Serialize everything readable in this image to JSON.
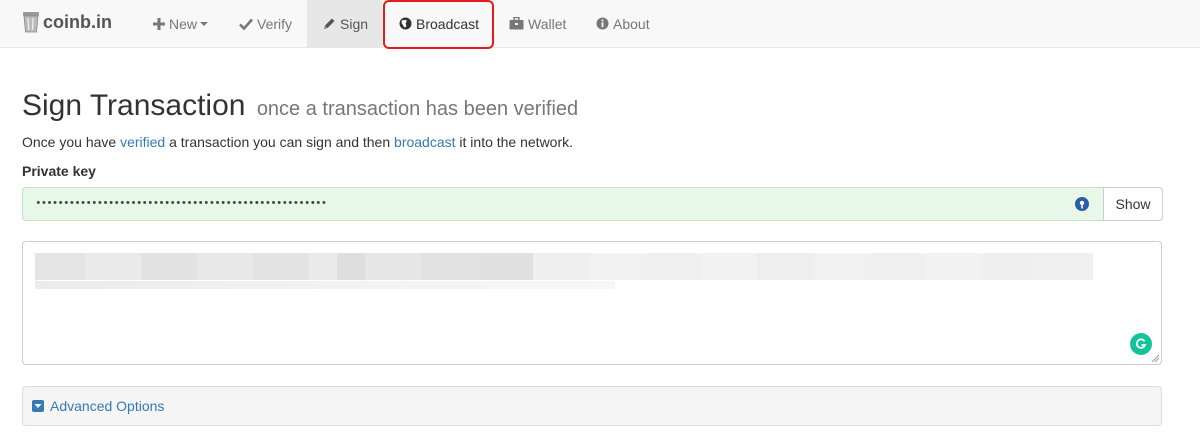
{
  "nav": {
    "brand": "coinb.in",
    "items": [
      {
        "label": "New",
        "icon": "plus-icon"
      },
      {
        "label": "Verify",
        "icon": "check-icon"
      },
      {
        "label": "Sign",
        "icon": "pencil-icon"
      },
      {
        "label": "Broadcast",
        "icon": "globe-icon"
      },
      {
        "label": "Wallet",
        "icon": "briefcase-icon"
      },
      {
        "label": "About",
        "icon": "info-icon"
      }
    ],
    "active": "Sign",
    "highlighted": "Broadcast"
  },
  "page": {
    "title": "Sign Transaction",
    "subtitle": "once a transaction has been verified",
    "intro_1": "Once you have ",
    "intro_link_1": "verified",
    "intro_2": " a transaction you can sign and then ",
    "intro_link_2": "broadcast",
    "intro_3": " it into the network."
  },
  "form": {
    "private_key_label": "Private key",
    "private_key_value": "••••••••••••••••••••••••••••••••••••••••••••••••••••",
    "show_button": "Show",
    "transaction_value": ""
  },
  "advanced": {
    "label": "Advanced Options"
  },
  "colors": {
    "link": "#337ab7",
    "highlight_border": "#e31b1b",
    "key_input_bg": "#e8f8e8"
  }
}
